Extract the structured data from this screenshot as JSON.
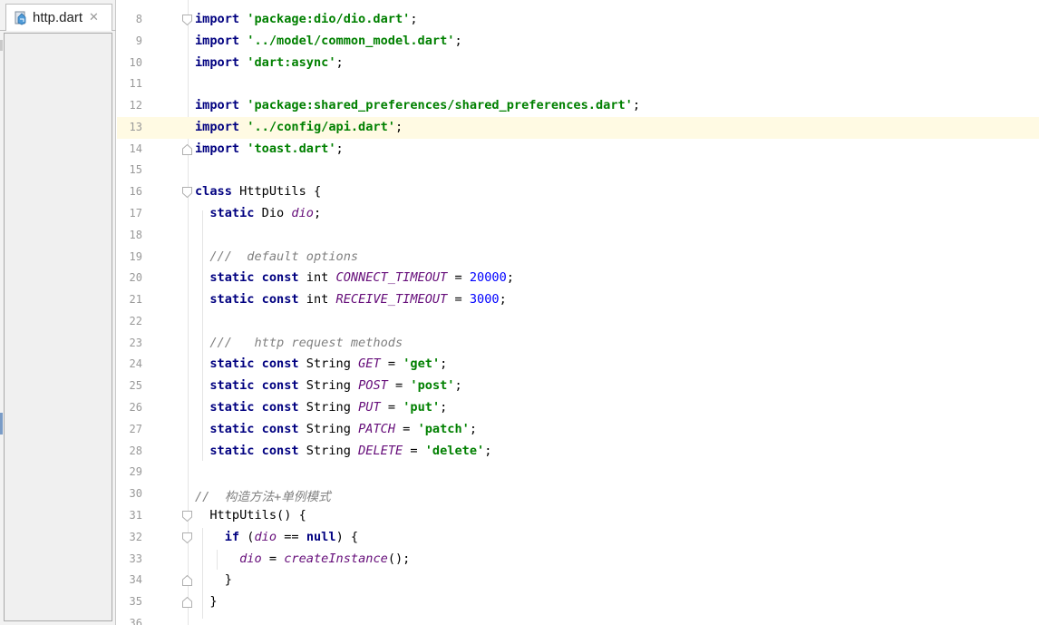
{
  "tab": {
    "label": "http.dart",
    "close": "✕",
    "icon": "dart-file-icon"
  },
  "editor": {
    "current_line": 13,
    "lines": [
      {
        "number": "8",
        "tokens": [
          {
            "text": "import",
            "kind": "kw"
          },
          {
            "text": " ",
            "kind": "plain"
          },
          {
            "text": "'package:dio/dio.dart'",
            "kind": "str"
          },
          {
            "text": ";",
            "kind": "plain"
          }
        ]
      },
      {
        "number": "9",
        "tokens": [
          {
            "text": "import",
            "kind": "kw"
          },
          {
            "text": " ",
            "kind": "plain"
          },
          {
            "text": "'../model/common_model.dart'",
            "kind": "str"
          },
          {
            "text": ";",
            "kind": "plain"
          }
        ]
      },
      {
        "number": "10",
        "tokens": [
          {
            "text": "import",
            "kind": "kw"
          },
          {
            "text": " ",
            "kind": "plain"
          },
          {
            "text": "'dart:async'",
            "kind": "str"
          },
          {
            "text": ";",
            "kind": "plain"
          }
        ]
      },
      {
        "number": "11",
        "tokens": []
      },
      {
        "number": "12",
        "tokens": [
          {
            "text": "import",
            "kind": "kw"
          },
          {
            "text": " ",
            "kind": "plain"
          },
          {
            "text": "'package:shared_preferences/shared_preferences.dart'",
            "kind": "str"
          },
          {
            "text": ";",
            "kind": "plain"
          }
        ]
      },
      {
        "number": "13",
        "tokens": [
          {
            "text": "import",
            "kind": "kw"
          },
          {
            "text": " ",
            "kind": "plain"
          },
          {
            "text": "'../config/api.dart'",
            "kind": "str"
          },
          {
            "text": ";",
            "kind": "plain"
          }
        ]
      },
      {
        "number": "14",
        "tokens": [
          {
            "text": "import",
            "kind": "kw"
          },
          {
            "text": " ",
            "kind": "plain"
          },
          {
            "text": "'toast.dart'",
            "kind": "str"
          },
          {
            "text": ";",
            "kind": "plain"
          }
        ]
      },
      {
        "number": "15",
        "tokens": []
      },
      {
        "number": "16",
        "tokens": [
          {
            "text": "class",
            "kind": "kw"
          },
          {
            "text": " HttpUtils {",
            "kind": "plain"
          }
        ]
      },
      {
        "number": "17",
        "tokens": [
          {
            "text": "  ",
            "kind": "plain"
          },
          {
            "text": "static",
            "kind": "kw"
          },
          {
            "text": " Dio ",
            "kind": "plain"
          },
          {
            "text": "dio",
            "kind": "cn"
          },
          {
            "text": ";",
            "kind": "plain"
          }
        ]
      },
      {
        "number": "18",
        "tokens": []
      },
      {
        "number": "19",
        "tokens": [
          {
            "text": "  ",
            "kind": "plain"
          },
          {
            "text": "///  default options",
            "kind": "cm"
          }
        ]
      },
      {
        "number": "20",
        "tokens": [
          {
            "text": "  ",
            "kind": "plain"
          },
          {
            "text": "static const",
            "kind": "kw"
          },
          {
            "text": " int ",
            "kind": "plain"
          },
          {
            "text": "CONNECT_TIMEOUT",
            "kind": "cn"
          },
          {
            "text": " = ",
            "kind": "plain"
          },
          {
            "text": "20000",
            "kind": "num"
          },
          {
            "text": ";",
            "kind": "plain"
          }
        ]
      },
      {
        "number": "21",
        "tokens": [
          {
            "text": "  ",
            "kind": "plain"
          },
          {
            "text": "static const",
            "kind": "kw"
          },
          {
            "text": " int ",
            "kind": "plain"
          },
          {
            "text": "RECEIVE_TIMEOUT",
            "kind": "cn"
          },
          {
            "text": " = ",
            "kind": "plain"
          },
          {
            "text": "3000",
            "kind": "num"
          },
          {
            "text": ";",
            "kind": "plain"
          }
        ]
      },
      {
        "number": "22",
        "tokens": []
      },
      {
        "number": "23",
        "tokens": [
          {
            "text": "  ",
            "kind": "plain"
          },
          {
            "text": "///   http request methods",
            "kind": "cm"
          }
        ]
      },
      {
        "number": "24",
        "tokens": [
          {
            "text": "  ",
            "kind": "plain"
          },
          {
            "text": "static const",
            "kind": "kw"
          },
          {
            "text": " String ",
            "kind": "plain"
          },
          {
            "text": "GET",
            "kind": "cn"
          },
          {
            "text": " = ",
            "kind": "plain"
          },
          {
            "text": "'get'",
            "kind": "str"
          },
          {
            "text": ";",
            "kind": "plain"
          }
        ]
      },
      {
        "number": "25",
        "tokens": [
          {
            "text": "  ",
            "kind": "plain"
          },
          {
            "text": "static const",
            "kind": "kw"
          },
          {
            "text": " String ",
            "kind": "plain"
          },
          {
            "text": "POST",
            "kind": "cn"
          },
          {
            "text": " = ",
            "kind": "plain"
          },
          {
            "text": "'post'",
            "kind": "str"
          },
          {
            "text": ";",
            "kind": "plain"
          }
        ]
      },
      {
        "number": "26",
        "tokens": [
          {
            "text": "  ",
            "kind": "plain"
          },
          {
            "text": "static const",
            "kind": "kw"
          },
          {
            "text": " String ",
            "kind": "plain"
          },
          {
            "text": "PUT",
            "kind": "cn"
          },
          {
            "text": " = ",
            "kind": "plain"
          },
          {
            "text": "'put'",
            "kind": "str"
          },
          {
            "text": ";",
            "kind": "plain"
          }
        ]
      },
      {
        "number": "27",
        "tokens": [
          {
            "text": "  ",
            "kind": "plain"
          },
          {
            "text": "static const",
            "kind": "kw"
          },
          {
            "text": " String ",
            "kind": "plain"
          },
          {
            "text": "PATCH",
            "kind": "cn"
          },
          {
            "text": " = ",
            "kind": "plain"
          },
          {
            "text": "'patch'",
            "kind": "str"
          },
          {
            "text": ";",
            "kind": "plain"
          }
        ]
      },
      {
        "number": "28",
        "tokens": [
          {
            "text": "  ",
            "kind": "plain"
          },
          {
            "text": "static const",
            "kind": "kw"
          },
          {
            "text": " String ",
            "kind": "plain"
          },
          {
            "text": "DELETE",
            "kind": "cn"
          },
          {
            "text": " = ",
            "kind": "plain"
          },
          {
            "text": "'delete'",
            "kind": "str"
          },
          {
            "text": ";",
            "kind": "plain"
          }
        ]
      },
      {
        "number": "29",
        "tokens": []
      },
      {
        "number": "30",
        "tokens": [
          {
            "text": "//  构造方法+单例模式",
            "kind": "cm"
          }
        ]
      },
      {
        "number": "31",
        "tokens": [
          {
            "text": "  HttpUtils() {",
            "kind": "plain"
          }
        ]
      },
      {
        "number": "32",
        "tokens": [
          {
            "text": "    ",
            "kind": "plain"
          },
          {
            "text": "if",
            "kind": "kw"
          },
          {
            "text": " (",
            "kind": "plain"
          },
          {
            "text": "dio",
            "kind": "cn"
          },
          {
            "text": " == ",
            "kind": "plain"
          },
          {
            "text": "null",
            "kind": "kw"
          },
          {
            "text": ") {",
            "kind": "plain"
          }
        ]
      },
      {
        "number": "33",
        "tokens": [
          {
            "text": "      ",
            "kind": "plain"
          },
          {
            "text": "dio",
            "kind": "cn"
          },
          {
            "text": " = ",
            "kind": "plain"
          },
          {
            "text": "createInstance",
            "kind": "cn"
          },
          {
            "text": "();",
            "kind": "plain"
          }
        ]
      },
      {
        "number": "34",
        "tokens": [
          {
            "text": "    }",
            "kind": "plain"
          }
        ]
      },
      {
        "number": "35",
        "tokens": [
          {
            "text": "  }",
            "kind": "plain"
          }
        ]
      },
      {
        "number": "36",
        "tokens": []
      }
    ]
  },
  "colors": {
    "keyword": "#000080",
    "string": "#008000",
    "comment": "#808080",
    "constant": "#660e7a",
    "number": "#0000ff",
    "current_line": "#fffae3"
  }
}
